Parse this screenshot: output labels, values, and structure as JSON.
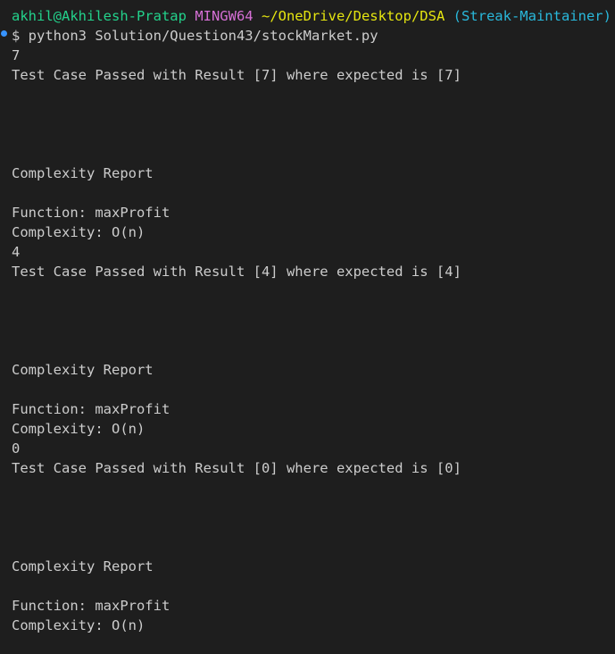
{
  "prompt": {
    "user_host": "akhil@Akhilesh-Pratap",
    "env": "MINGW64",
    "cwd": "~/OneDrive/Desktop/DSA",
    "branch": "(Streak-Maintainer)"
  },
  "command": "$ python3 Solution/Question43/stockMarket.py",
  "runs": [
    {
      "output": "7",
      "result": "Test Case Passed with Result [7] where expected is [7]",
      "report_title": "Complexity Report",
      "function": "Function: maxProfit",
      "complexity": "Complexity: O(n)"
    },
    {
      "output": "4",
      "result": "Test Case Passed with Result [4] where expected is [4]",
      "report_title": "Complexity Report",
      "function": "Function: maxProfit",
      "complexity": "Complexity: O(n)"
    },
    {
      "output": "0",
      "result": "Test Case Passed with Result [0] where expected is [0]",
      "report_title": "Complexity Report",
      "function": "Function: maxProfit",
      "complexity": "Complexity: O(n)"
    }
  ],
  "colors": {
    "background": "#1e1e1e",
    "text": "#cccccc",
    "user_host": "#23d18b",
    "env": "#d670d6",
    "cwd": "#e5e510",
    "branch": "#29b8db",
    "command_marker": "#3794ff"
  }
}
